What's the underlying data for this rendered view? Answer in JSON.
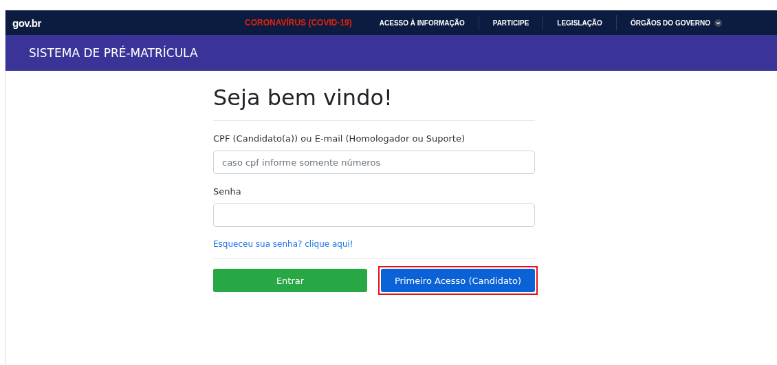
{
  "govbar": {
    "logo": "gov.br",
    "links": [
      {
        "label": "CORONAVÍRUS (COVID-19)",
        "alert": true,
        "dropdown": false
      },
      {
        "label": "ACESSO À INFORMAÇÃO",
        "alert": false,
        "dropdown": false
      },
      {
        "label": "PARTICIPE",
        "alert": false,
        "dropdown": false
      },
      {
        "label": "LEGISLAÇÃO",
        "alert": false,
        "dropdown": false
      },
      {
        "label": "ÓRGÃOS DO GOVERNO",
        "alert": false,
        "dropdown": true
      }
    ]
  },
  "header": {
    "title": "SISTEMA DE PRÉ-MATRÍCULA"
  },
  "form": {
    "heading": "Seja bem vindo!",
    "fields": [
      {
        "label": "CPF (Candidato(a)) ou E-mail (Homologador ou Suporte)",
        "placeholder": "caso cpf informe somente números"
      },
      {
        "label": "Senha"
      }
    ],
    "forgot_link": "Esqueceu sua senha? clique aqui!",
    "buttons": [
      {
        "label": "Entrar",
        "kind": "success",
        "highlighted": false
      },
      {
        "label": "Primeiro Acesso (Candidato)",
        "kind": "primary",
        "highlighted": true
      }
    ]
  }
}
